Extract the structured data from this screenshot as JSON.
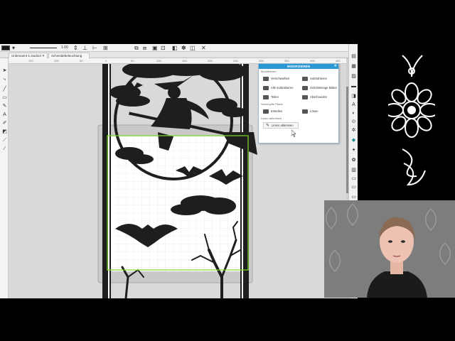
{
  "toolbar": {
    "stroke_value": "1.00",
    "icons": [
      "color-swatch-icon",
      "align-icon",
      "group-icon",
      "ungroup-icon",
      "arrange-icon",
      "close-icon"
    ]
  },
  "tabs": [
    {
      "label": "Unbenannt-1.studio3"
    },
    {
      "label": "Schneidebeleuchtung"
    }
  ],
  "ruler_ticks": [
    "150",
    "100",
    "50",
    "0",
    "50",
    "100",
    "150",
    "200",
    "250",
    "300",
    "350",
    "400",
    "450"
  ],
  "modify_panel": {
    "title": "MODIFIZIEREN",
    "section_modify": "Modifizieren",
    "buttons": [
      {
        "label": "Verschweißen"
      },
      {
        "label": "Subtrahieren"
      },
      {
        "label": "Alle subtrahieren"
      },
      {
        "label": "Schnittmenge bilden"
      },
      {
        "label": "Teilen"
      },
      {
        "label": "Abschneiden"
      }
    ],
    "section_compound": "Verknüpfte Pfade",
    "compound_buttons": [
      {
        "label": "Erstellen"
      },
      {
        "label": "Lösen"
      }
    ],
    "section_lines": "Linien abkreisen",
    "line_button": "Linien abkreisen"
  },
  "colors": {
    "panel_header": "#2a98d6",
    "selection_green": "#7ee02a",
    "accent_teal": "#1e8c8c",
    "silhouette": "#1e1e1e"
  }
}
